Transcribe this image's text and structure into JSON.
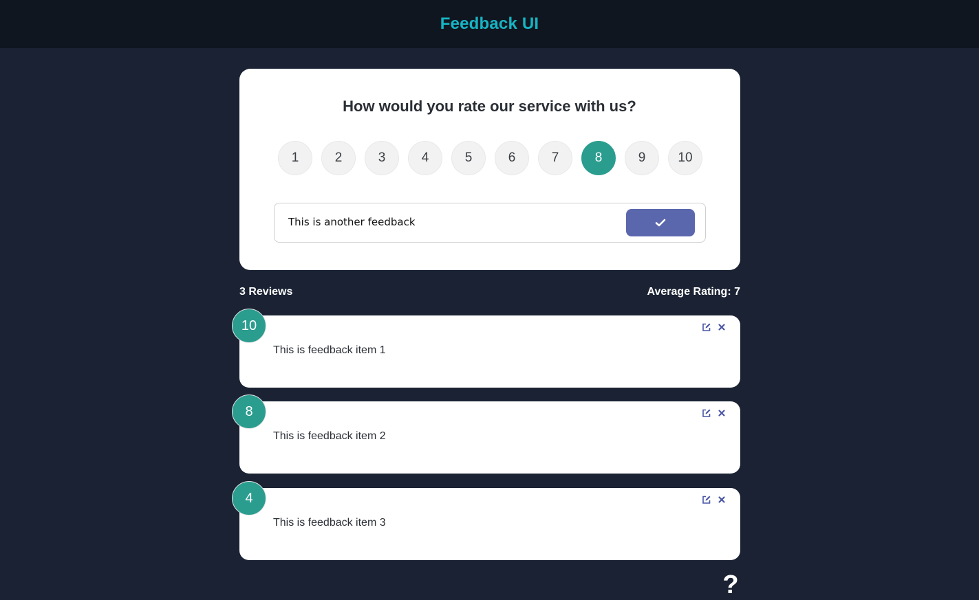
{
  "header": {
    "title": "Feedback UI"
  },
  "form": {
    "question": "How would you rate our service with us?",
    "rating_options": [
      "1",
      "2",
      "3",
      "4",
      "5",
      "6",
      "7",
      "8",
      "9",
      "10"
    ],
    "selected_rating": "8",
    "input_value": "This is another feedback",
    "send_icon": "check-icon"
  },
  "stats": {
    "reviews": "3 Reviews",
    "average": "Average Rating: 7"
  },
  "feedback_items": [
    {
      "rating": "10",
      "text": "This is feedback item 1"
    },
    {
      "rating": "8",
      "text": "This is feedback item 2"
    },
    {
      "rating": "4",
      "text": "This is feedback item 3"
    }
  ],
  "help": {
    "label": "?"
  },
  "colors": {
    "accent": "#2a9d8f",
    "title": "#16b5c4",
    "button": "#5b67ad",
    "background": "#1a2233"
  }
}
